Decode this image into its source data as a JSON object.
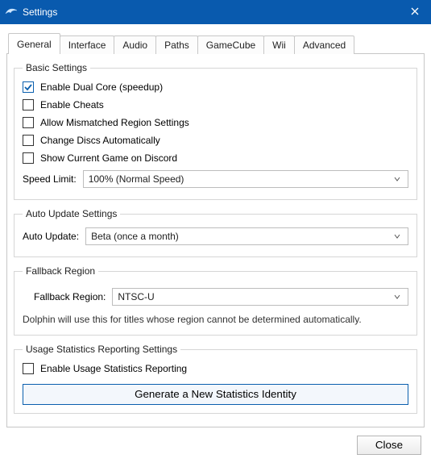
{
  "window": {
    "title": "Settings",
    "close_label": "Close"
  },
  "tabs": [
    {
      "label": "General"
    },
    {
      "label": "Interface"
    },
    {
      "label": "Audio"
    },
    {
      "label": "Paths"
    },
    {
      "label": "GameCube"
    },
    {
      "label": "Wii"
    },
    {
      "label": "Advanced"
    }
  ],
  "basic": {
    "legend": "Basic Settings",
    "enable_dual_core": "Enable Dual Core (speedup)",
    "enable_cheats": "Enable Cheats",
    "allow_mismatched": "Allow Mismatched Region Settings",
    "change_discs": "Change Discs Automatically",
    "show_discord": "Show Current Game on Discord",
    "speed_limit_label": "Speed Limit:",
    "speed_limit_value": "100% (Normal Speed)"
  },
  "auto_update": {
    "legend": "Auto Update Settings",
    "label": "Auto Update:",
    "value": "Beta (once a month)"
  },
  "fallback": {
    "legend": "Fallback Region",
    "label": "Fallback Region:",
    "value": "NTSC-U",
    "hint": "Dolphin will use this for titles whose region cannot be determined automatically."
  },
  "usage": {
    "legend": "Usage Statistics Reporting Settings",
    "enable_label": "Enable Usage Statistics Reporting",
    "generate_btn": "Generate a New Statistics Identity"
  },
  "footer": {
    "close": "Close"
  }
}
